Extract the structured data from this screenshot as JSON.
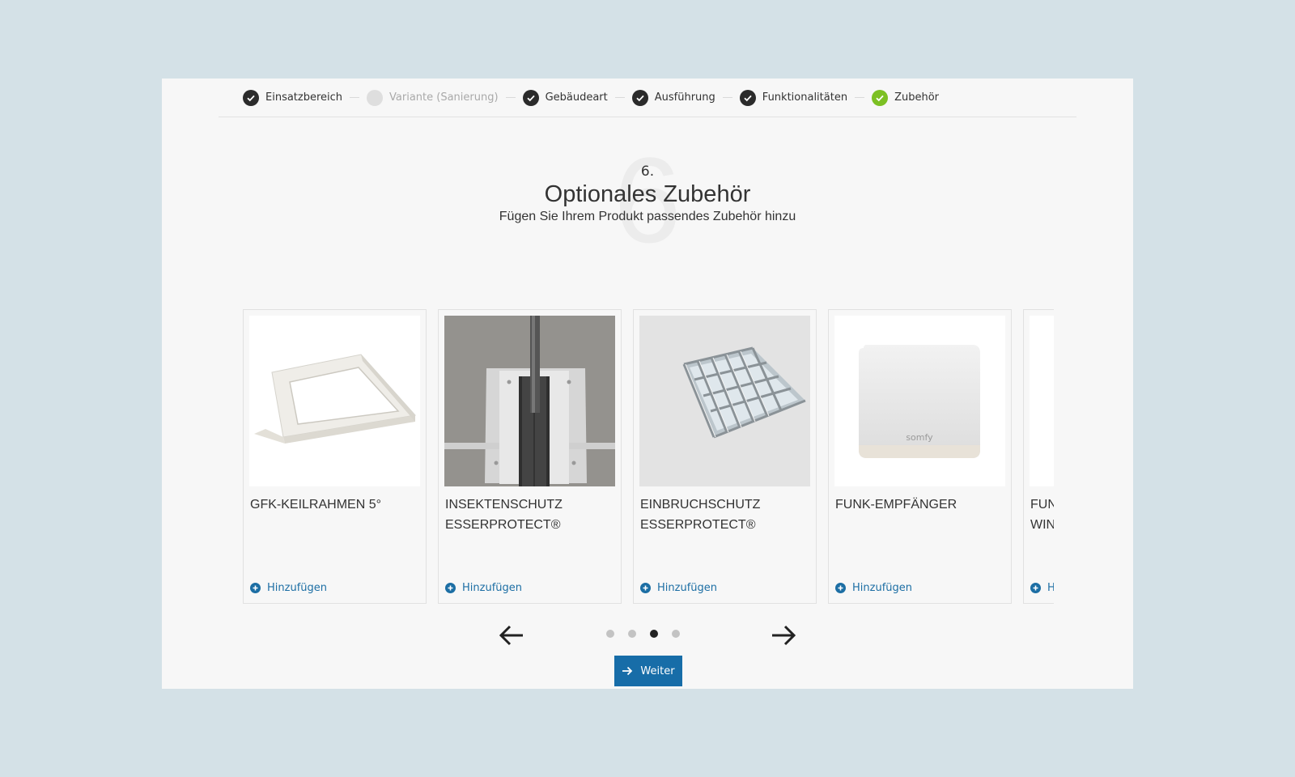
{
  "steps": [
    {
      "label": "Einsatzbereich",
      "state": "done"
    },
    {
      "label": "Variante (Sanierung)",
      "state": "disabled"
    },
    {
      "label": "Gebäudeart",
      "state": "done"
    },
    {
      "label": "Ausführung",
      "state": "done"
    },
    {
      "label": "Funktionalitäten",
      "state": "done"
    },
    {
      "label": "Zubehör",
      "state": "current"
    }
  ],
  "hero": {
    "big_number": "6",
    "step_number": "6.",
    "title": "Optionales Zubehör",
    "subtitle": "Fügen Sie Ihrem Produkt passendes Zubehör hinzu"
  },
  "products": [
    {
      "name_line1": "GFK-KEILRAHMEN 5°",
      "name_line2": "",
      "add_label": "Hinzufügen"
    },
    {
      "name_line1": "INSEKTENSCHUTZ",
      "name_line2": "ESSERPROTECT®",
      "add_label": "Hinzufügen"
    },
    {
      "name_line1": "EINBRUCHSCHUTZ",
      "name_line2": "ESSERPROTECT®",
      "add_label": "Hinzufügen"
    },
    {
      "name_line1": "FUNK-EMPFÄNGER",
      "name_line2": "",
      "add_label": "Hinzufügen"
    },
    {
      "name_line1": "FUN",
      "name_line2": "WIN",
      "add_label": "H"
    }
  ],
  "product_image_brand": "somfy",
  "pagination": {
    "count": 4,
    "active_index": 2
  },
  "weiter_label": "Weiter",
  "colors": {
    "background": "#d4e1e7",
    "panel": "#f7f7f7",
    "done_step": "#2b2b2b",
    "current_step": "#7cc023",
    "link_blue": "#1c6ea4",
    "button_blue": "#176da8"
  }
}
